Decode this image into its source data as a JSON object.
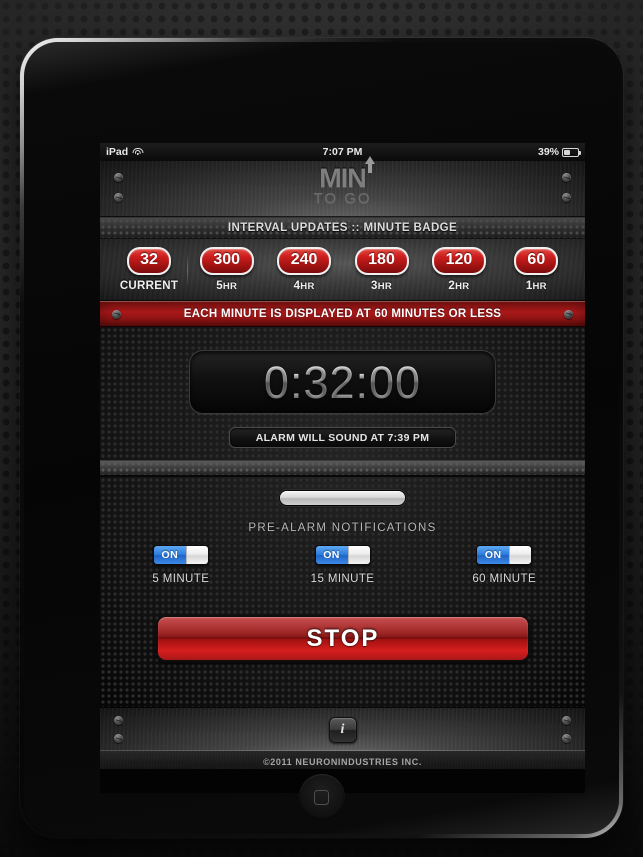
{
  "device": {
    "name": "ipad",
    "home_button": "home-button"
  },
  "status_bar": {
    "carrier": "iPad",
    "wifi_icon": "wifi-icon",
    "time": "7:07 PM",
    "battery_percent": "39%",
    "battery_icon": "battery-icon",
    "battery_level": 39
  },
  "logo": {
    "main": "MIN",
    "sub": "TO GO",
    "arrow_icon": "up-arrow-icon"
  },
  "interval_section": {
    "header": "INTERVAL UPDATES :: MINUTE BADGE",
    "badges": [
      {
        "value": "32",
        "label": "CURRENT",
        "hr": "",
        "current": true
      },
      {
        "value": "300",
        "label": "5",
        "hr": "HR",
        "current": false
      },
      {
        "value": "240",
        "label": "4",
        "hr": "HR",
        "current": false
      },
      {
        "value": "180",
        "label": "3",
        "hr": "HR",
        "current": false
      },
      {
        "value": "120",
        "label": "2",
        "hr": "HR",
        "current": false
      },
      {
        "value": "60",
        "label": "1",
        "hr": "HR",
        "current": false
      }
    ]
  },
  "banner": {
    "text": "EACH MINUTE IS DISPLAYED AT 60 MINUTES OR LESS"
  },
  "timer": {
    "display": "0:32:00",
    "alarm_notice": "ALARM WILL SOUND AT 7:39 PM",
    "progress_percent": 100
  },
  "pre_alarm": {
    "title": "PRE-ALARM NOTIFICATIONS",
    "toggles": [
      {
        "state": "ON",
        "label": "5 MINUTE"
      },
      {
        "state": "ON",
        "label": "15 MINUTE"
      },
      {
        "state": "ON",
        "label": "60 MINUTE"
      }
    ]
  },
  "actions": {
    "stop_label": "STOP"
  },
  "footer": {
    "info_icon": "info-icon",
    "info_label": "i",
    "copyright": "©2011 NEURONINDUSTRIES INC."
  },
  "colors": {
    "badge_red": "#cf1f1f",
    "banner_red": "#c01c1c",
    "stop_red": "#e81c1c",
    "toggle_blue": "#2b7de0"
  }
}
